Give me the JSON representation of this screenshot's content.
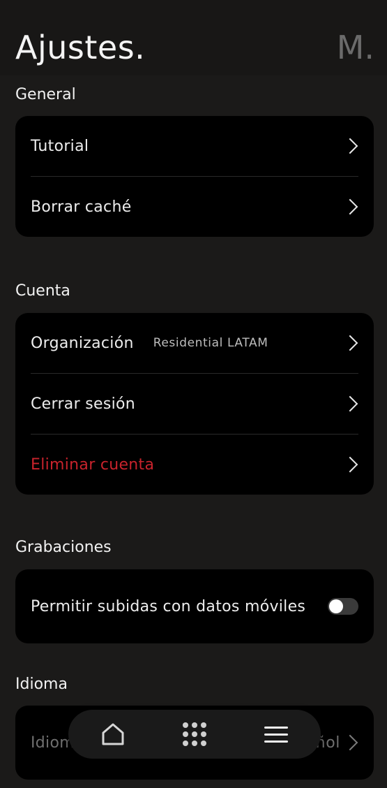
{
  "header": {
    "title": "Ajustes.",
    "avatar_initial": "M."
  },
  "sections": {
    "general": {
      "title": "General",
      "items": [
        {
          "label": "Tutorial"
        },
        {
          "label": "Borrar caché"
        }
      ]
    },
    "cuenta": {
      "title": "Cuenta",
      "items": [
        {
          "label": "Organización",
          "value": "Residential LATAM"
        },
        {
          "label": "Cerrar sesión"
        },
        {
          "label": "Eliminar cuenta"
        }
      ]
    },
    "grabaciones": {
      "title": "Grabaciones",
      "items": [
        {
          "label": "Permitir subidas con datos móviles",
          "toggle_on": false
        }
      ]
    },
    "idioma": {
      "title": "Idioma",
      "items": [
        {
          "label": "Idioma",
          "value": "Español"
        }
      ]
    }
  },
  "nav": {
    "items": [
      "home-icon",
      "grid-icon",
      "menu-icon"
    ]
  },
  "colors": {
    "danger": "#c8232c",
    "background": "#1b1a19",
    "card": "#000000"
  }
}
